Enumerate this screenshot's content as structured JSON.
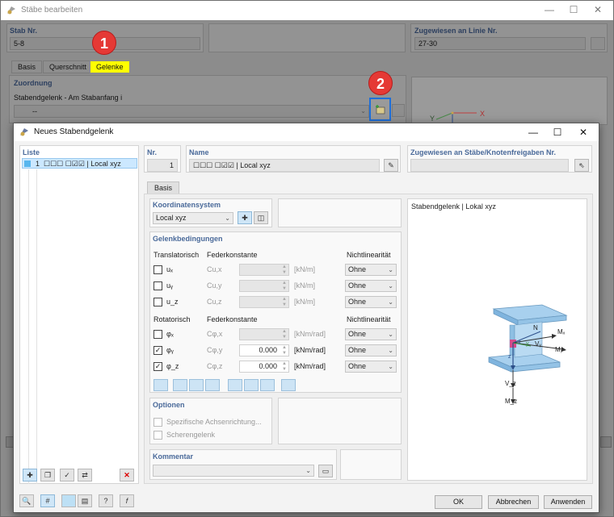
{
  "outer": {
    "title": "Stäbe bearbeiten",
    "stab_nr_label": "Stab Nr.",
    "stab_nr_value": "5-8",
    "assigned_label": "Zugewiesen an Linie Nr.",
    "assigned_value": "27-30",
    "tabs": [
      "Basis",
      "Querschnitt",
      "Gelenke"
    ],
    "zuordnung_label": "Zuordnung",
    "stabendgelenk_label": "Stabendgelenk - Am Stabanfang i",
    "stabendgelenk_value": "--",
    "axes": {
      "x": "X",
      "y": "Y"
    }
  },
  "badges": {
    "one": "1",
    "two": "2"
  },
  "inner": {
    "title": "Neues Stabendgelenk",
    "liste_label": "Liste",
    "list_items": [
      {
        "num": "1",
        "text": "☐☐☐ ☐☑☑ | Local xyz"
      }
    ],
    "nr_label": "Nr.",
    "nr_value": "1",
    "name_label": "Name",
    "name_value": "☐☐☐ ☐☑☑ | Local xyz",
    "assigned_label": "Zugewiesen an Stäbe/Knotenfreigaben Nr.",
    "tab_basis": "Basis",
    "koord_label": "Koordinatensystem",
    "koord_value": "Local xyz",
    "gelenk_label": "Gelenkbedingungen",
    "translatorisch": "Translatorisch",
    "rotatorisch": "Rotatorisch",
    "federkonstante": "Federkonstante",
    "nichtlinearitaet": "Nichtlinearität",
    "translational_rows": [
      {
        "sym": "uₓ",
        "c": "Cu,x",
        "value": "",
        "unit": "[kN/m]",
        "checked": false,
        "nl": "Ohne"
      },
      {
        "sym": "uᵧ",
        "c": "Cu,y",
        "value": "",
        "unit": "[kN/m]",
        "checked": false,
        "nl": "Ohne"
      },
      {
        "sym": "u_z",
        "c": "Cu,z",
        "value": "",
        "unit": "[kN/m]",
        "checked": false,
        "nl": "Ohne"
      }
    ],
    "rotational_rows": [
      {
        "sym": "φₓ",
        "c": "Cφ,x",
        "value": "",
        "unit": "[kNm/rad]",
        "checked": false,
        "nl": "Ohne"
      },
      {
        "sym": "φᵧ",
        "c": "Cφ,y",
        "value": "0.000",
        "unit": "[kNm/rad]",
        "checked": true,
        "nl": "Ohne"
      },
      {
        "sym": "φ_z",
        "c": "Cφ,z",
        "value": "0.000",
        "unit": "[kNm/rad]",
        "checked": true,
        "nl": "Ohne"
      }
    ],
    "preview_title": "Stabendgelenk | Lokal xyz",
    "optionen_label": "Optionen",
    "option1": "Spezifische Achsenrichtung...",
    "option2": "Scherengelenk",
    "kommentar_label": "Kommentar",
    "diagram_labels": {
      "mx": "Mₓ",
      "n": "N",
      "vy": "Vᵧ",
      "my": "Mᵧ",
      "x": "x",
      "y": "y",
      "z": "z",
      "vz": "V_z",
      "mz": "M_z"
    },
    "buttons": {
      "ok": "OK",
      "cancel": "Abbrechen",
      "apply": "Anwenden"
    }
  },
  "colors": {
    "accent": "#4a6a9a",
    "highlight": "#ffff00",
    "badge": "#e53935",
    "arrow": "#1e6fd9"
  }
}
